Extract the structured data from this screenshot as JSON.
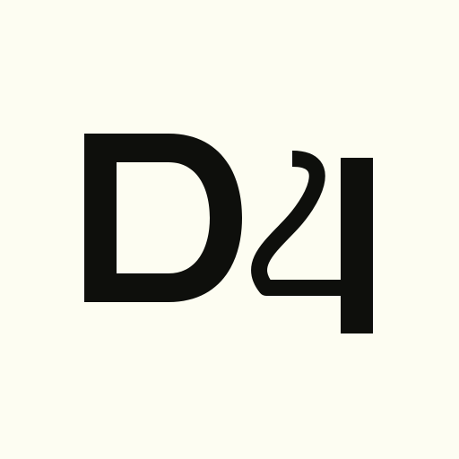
{
  "logo": {
    "text": "D4",
    "colors": {
      "background": "#fdfdf2",
      "ink": "#0e0f0c"
    }
  }
}
